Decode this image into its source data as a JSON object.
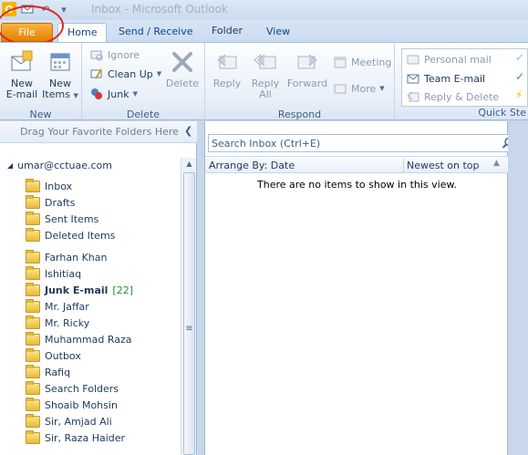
{
  "titlebar": {
    "app_icon_label": "O",
    "title": "Inbox - Microsoft Outlook"
  },
  "tabs": {
    "file": "File",
    "home": "Home",
    "send_receive": "Send / Receive",
    "folder": "Folder",
    "view": "View"
  },
  "ribbon": {
    "new_group": {
      "label": "New",
      "new_email": "New\nE-mail",
      "new_email_l1": "New",
      "new_email_l2": "E-mail",
      "new_items_l1": "New",
      "new_items_l2": "Items"
    },
    "delete_group": {
      "label": "Delete",
      "ignore": "Ignore",
      "clean_up": "Clean Up",
      "junk": "Junk",
      "delete": "Delete"
    },
    "respond_group": {
      "label": "Respond",
      "reply": "Reply",
      "reply_all_l1": "Reply",
      "reply_all_l2": "All",
      "forward": "Forward",
      "meeting": "Meeting",
      "more": "More"
    },
    "quick_steps": {
      "label": "Quick Ste",
      "personal_mail": "Personal mail",
      "team_email": "Team E-mail",
      "reply_delete": "Reply & Delete"
    }
  },
  "navpane": {
    "drag_header": "Drag Your Favorite Folders Here",
    "account": "umar@cctuae.com",
    "folders_top": [
      {
        "name": "Inbox",
        "icon": "inbox-icon"
      },
      {
        "name": "Drafts",
        "icon": "drafts-icon"
      },
      {
        "name": "Sent Items",
        "icon": "sent-icon"
      },
      {
        "name": "Deleted Items",
        "icon": "deleted-icon"
      }
    ],
    "folders": [
      {
        "name": "Farhan Khan"
      },
      {
        "name": "Ishitiaq"
      },
      {
        "name": "Junk E-mail",
        "count": "[22]"
      },
      {
        "name": "Mr. Jaffar"
      },
      {
        "name": "Mr. Ricky"
      },
      {
        "name": "Muhammad Raza"
      },
      {
        "name": "Outbox"
      },
      {
        "name": "Rafiq"
      },
      {
        "name": "Search Folders"
      },
      {
        "name": "Shoaib Mohsin"
      },
      {
        "name": "Sir, Amjad Ali"
      },
      {
        "name": "Sir, Raza Haider"
      }
    ]
  },
  "msglist": {
    "search_placeholder": "Search Inbox (Ctrl+E)",
    "arrange_by": "Arrange By: Date",
    "sort_order": "Newest on top",
    "empty_message": "There are no items to show in this view."
  },
  "colors": {
    "file_tab": "#e47f00",
    "highlight_circle": "#e0241b",
    "unread_count": "#2e8b2e"
  }
}
